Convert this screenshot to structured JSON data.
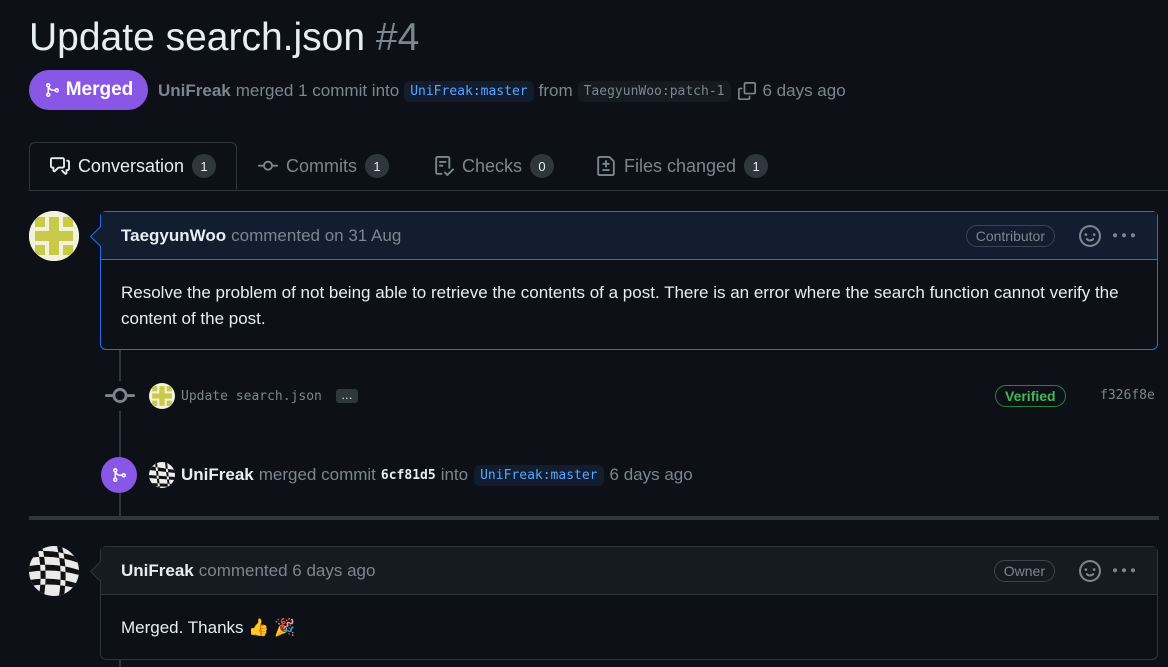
{
  "header": {
    "title": "Update search.json",
    "number": "#4",
    "status": "Merged",
    "merger": "UniFreak",
    "merged_text": "merged 1 commit into",
    "base_branch": "UniFreak:master",
    "from_text": "from",
    "head_branch": "TaegyunWoo:patch-1",
    "time": "6 days ago"
  },
  "tabs": [
    {
      "label": "Conversation",
      "count": "1",
      "icon": "comment-discussion-icon"
    },
    {
      "label": "Commits",
      "count": "1",
      "icon": "git-commit-icon"
    },
    {
      "label": "Checks",
      "count": "0",
      "icon": "checklist-icon"
    },
    {
      "label": "Files changed",
      "count": "1",
      "icon": "file-diff-icon"
    }
  ],
  "comment1": {
    "author": "TaegyunWoo",
    "action": "commented on 31 Aug",
    "role": "Contributor",
    "body": "Resolve the problem of not being able to retrieve the contents of a post. There is an error where the search function cannot verify the content of the post."
  },
  "commit": {
    "message": "Update search.json",
    "ellipsis": "…",
    "verified": "Verified",
    "sha": "f326f8e"
  },
  "merge_event": {
    "author": "UniFreak",
    "text": "merged commit",
    "sha": "6cf81d5",
    "into": "into",
    "branch": "UniFreak:master",
    "time": "6 days ago"
  },
  "comment2": {
    "author": "UniFreak",
    "action": "commented 6 days ago",
    "role": "Owner",
    "body": "Merged. Thanks 👍 🎉"
  },
  "colors": {
    "merged": "#8957e5",
    "link": "#58a6ff",
    "verified": "#3fb950",
    "background": "#0d1117"
  }
}
